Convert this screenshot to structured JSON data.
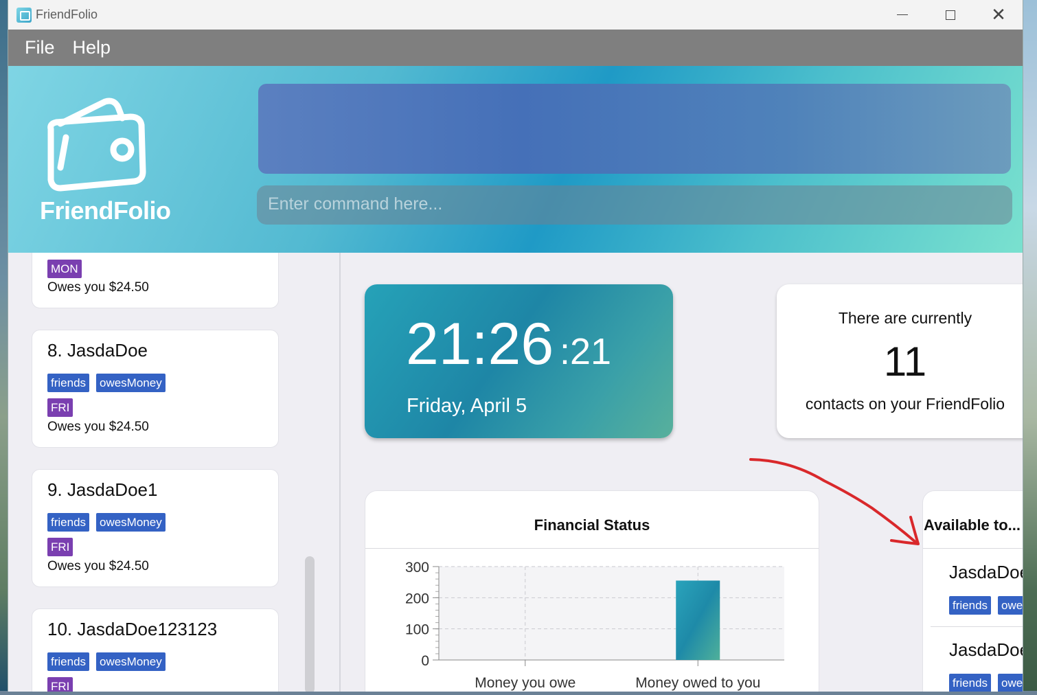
{
  "window": {
    "title": "FriendFolio",
    "controls": {
      "minimize": "minimize",
      "maximize": "maximize",
      "close": "✕"
    }
  },
  "menu": [
    "File",
    "Help"
  ],
  "header": {
    "logo_text": "FriendFolio",
    "command_placeholder": "Enter command here..."
  },
  "contacts": [
    {
      "title": "",
      "tags": [],
      "days": [
        "MON"
      ],
      "owes": "Owes you $24.50"
    },
    {
      "title": "8.  JasdaDoe",
      "tags": [
        "friends",
        "owesMoney"
      ],
      "days": [
        "FRI"
      ],
      "owes": "Owes you $24.50"
    },
    {
      "title": "9.  JasdaDoe1",
      "tags": [
        "friends",
        "owesMoney"
      ],
      "days": [
        "FRI"
      ],
      "owes": "Owes you $24.50"
    },
    {
      "title": "10.  JasdaDoe123123",
      "tags": [
        "friends",
        "owesMoney"
      ],
      "days": [
        "FRI"
      ],
      "owes": ""
    }
  ],
  "clock": {
    "hm": "21:26",
    "sec": ":21",
    "date": "Friday, April 5"
  },
  "count": {
    "line1": "There are currently",
    "number": "11",
    "line2": "contacts on your FriendFolio"
  },
  "financial": {
    "title": "Financial Status",
    "chart_data": {
      "type": "bar",
      "categories": [
        "Money you owe",
        "Money owed to you"
      ],
      "values": [
        0,
        255
      ],
      "ylim": [
        0,
        300
      ],
      "yticks": [
        0,
        100,
        200,
        300
      ],
      "grid": true,
      "bar_color": "#1e8aa8"
    }
  },
  "available": {
    "title": "Available to...",
    "items": [
      {
        "name": "JasdaDoe",
        "tags": [
          "friends",
          "owe"
        ]
      },
      {
        "name": "JasdaDoe",
        "tags": [
          "friends",
          "owe"
        ]
      }
    ]
  },
  "annotation": {
    "color": "#d9282b",
    "kind": "hand-drawn arrow"
  }
}
